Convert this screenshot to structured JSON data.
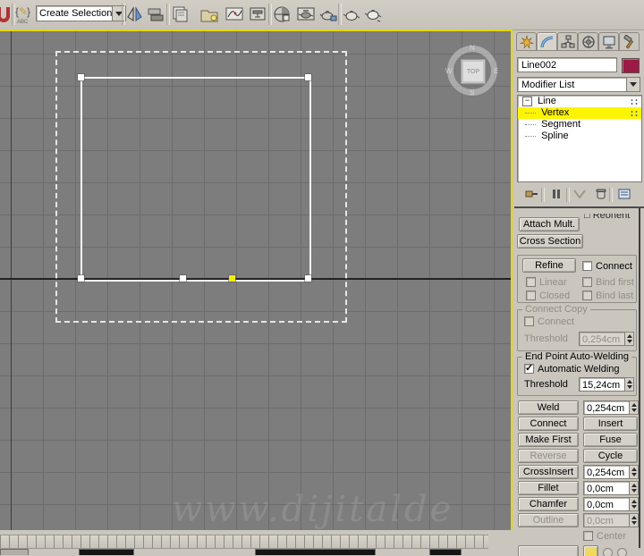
{
  "toolbar": {
    "selection_set_value": "Create Selection Se"
  },
  "viewport": {
    "view_label": "TOP",
    "compass": {
      "n": "N",
      "e": "E",
      "s": "S",
      "w": "W"
    },
    "watermark": "www.dijitalde"
  },
  "panel": {
    "object_name": "Line002",
    "object_color": "#9c1a45",
    "modifier_list_label": "Modifier List",
    "stack": {
      "root": "Line",
      "items": [
        "Vertex",
        "Segment",
        "Spline"
      ],
      "selected": "Vertex"
    },
    "rollout": {
      "attach_mult": "Attach Mult.",
      "cross_section": "Cross Section",
      "refine": "Refine",
      "connect_check": "Connect",
      "linear": "Linear",
      "bind_first": "Bind first",
      "closed": "Closed",
      "bind_last": "Bind last",
      "connect_copy_title": "Connect Copy",
      "connect_copy_check": "Connect",
      "threshold_label": "Threshold",
      "connect_copy_threshold": "0,254cm",
      "autoweld_title": "End Point Auto-Welding",
      "autoweld_check": "Automatic Welding",
      "autoweld_threshold": "15,24cm",
      "weld": "Weld",
      "weld_value": "0,254cm",
      "connect_btn": "Connect",
      "insert": "Insert",
      "make_first": "Make First",
      "fuse": "Fuse",
      "reverse": "Reverse",
      "cycle": "Cycle",
      "crossinsert": "CrossInsert",
      "crossinsert_value": "0,254cm",
      "fillet": "Fillet",
      "fillet_value": "0,0cm",
      "chamfer": "Chamfer",
      "chamfer_value": "0,0cm",
      "outline": "Outline",
      "outline_value": "0,0cm",
      "center": "Center"
    }
  },
  "colors": {
    "viewport_border": "#e4d600",
    "selected_vertex": "#f2ee00",
    "stack_highlight": "#fdf402",
    "object_swatch": "#9c1a45"
  }
}
